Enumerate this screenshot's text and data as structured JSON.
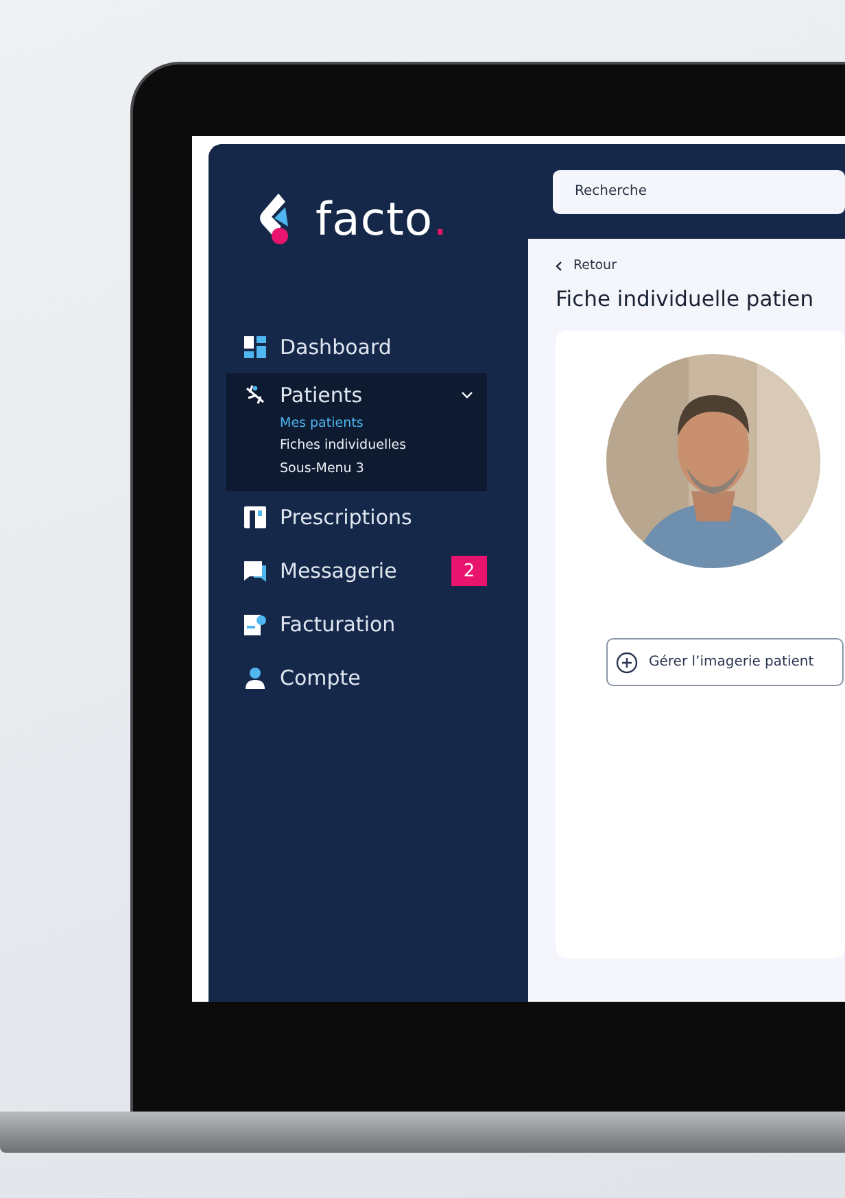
{
  "logo": {
    "name": "facto",
    "dot": "."
  },
  "sidebar": {
    "items": [
      {
        "label": "Dashboard",
        "kind": "dashboard",
        "expanded": false
      },
      {
        "label": "Patients",
        "kind": "patients",
        "expanded": true,
        "children": [
          {
            "label": "Mes patients",
            "selected": true
          },
          {
            "label": "Fiches individuelles",
            "selected": false
          },
          {
            "label": "Sous-Menu 3",
            "selected": false
          }
        ]
      },
      {
        "label": "Prescriptions",
        "kind": "prescriptions",
        "expanded": false
      },
      {
        "label": "Messagerie",
        "kind": "messages",
        "expanded": false,
        "badge": "2"
      },
      {
        "label": "Facturation",
        "kind": "billing",
        "expanded": false
      },
      {
        "label": "Compte",
        "kind": "account",
        "expanded": false
      }
    ]
  },
  "search": {
    "placeholder": "Recherche"
  },
  "back_link": {
    "label": "Retour"
  },
  "page_title": "Fiche individuelle patien",
  "patient_card": {
    "button": {
      "label": "Gérer l’imagerie patient"
    }
  }
}
